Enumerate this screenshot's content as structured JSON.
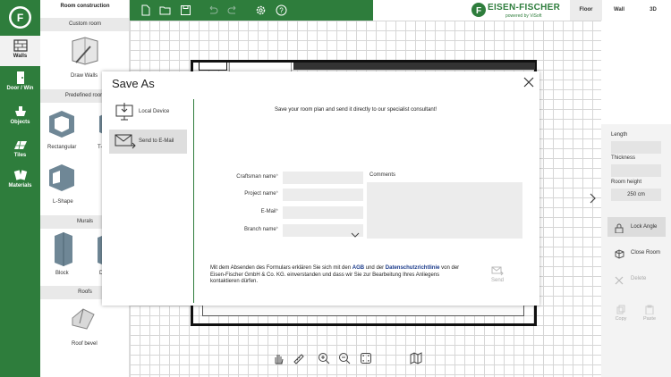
{
  "left_rail": {
    "items": [
      {
        "label": "Walls",
        "icon": "walls-icon",
        "active": true
      },
      {
        "label": "Door / Win",
        "icon": "door-window-icon"
      },
      {
        "label": "Objects",
        "icon": "objects-icon"
      },
      {
        "label": "Tiles",
        "icon": "tiles-icon"
      },
      {
        "label": "Materials",
        "icon": "materials-icon"
      }
    ]
  },
  "left_panel": {
    "title": "Room construction",
    "custom_room": {
      "heading": "Custom room",
      "items": [
        {
          "label": "Draw Walls"
        }
      ]
    },
    "predefined_room": {
      "heading": "Predefined room",
      "items": [
        {
          "label": "Rectangular"
        },
        {
          "label": "T-"
        },
        {
          "label": "L-Shape"
        }
      ]
    },
    "murals": {
      "heading": "Murals",
      "items": [
        {
          "label": "Block"
        },
        {
          "label": "D"
        }
      ]
    },
    "roofs": {
      "heading": "Roofs",
      "items": [
        {
          "label": "Roof bevel"
        }
      ]
    }
  },
  "topbar": {
    "icons": [
      "new-file-icon",
      "open-folder-icon",
      "save-icon",
      "undo-icon",
      "redo-icon",
      "settings-icon",
      "help-icon"
    ]
  },
  "brand": {
    "name": "EISEN-FISCHER",
    "tagline": "powered by ViSoft"
  },
  "view_tabs": [
    {
      "label": "Floor",
      "active": true
    },
    {
      "label": "Wall"
    },
    {
      "label": "3D"
    }
  ],
  "right_panel": {
    "length_label": "Length",
    "length_value": "",
    "thickness_label": "Thickness",
    "thickness_value": "",
    "room_height_label": "Room height",
    "room_height_value": "250 cm",
    "lock_angle": "Lock Angle",
    "close_room": "Close Room",
    "delete": "Delete",
    "copy": "Copy",
    "paste": "Paste"
  },
  "dialog": {
    "title": "Save As",
    "options": [
      {
        "label": "Local Device"
      },
      {
        "label": "Send to E-Mail",
        "selected": true
      }
    ],
    "intro": "Save your room plan and send it directly to our specialist consultant!",
    "fields": {
      "craftsman_name": {
        "label": "Craftsman name",
        "value": ""
      },
      "project_name": {
        "label": "Project name",
        "value": ""
      },
      "email": {
        "label": "E-Mail",
        "value": ""
      },
      "branch_name": {
        "label": "Branch name",
        "value": ""
      }
    },
    "required_mark": "*",
    "comments_label": "Comments",
    "consent_pre": "Mit dem Absenden des Formulars erklären Sie sich mit den ",
    "consent_agb": "AGB",
    "consent_mid": " und der ",
    "consent_privacy": "Datenschutzrichtlinie",
    "consent_post": " von der Eisen-Fischer GmbH & Co. KG. einverstanden und dass wir Sie zur Bearbeitung Ihres Anliegens kontaktieren dürfen.",
    "send_label": "Send"
  },
  "bottom_toolbar": {
    "icons": [
      "hand-pan-icon",
      "ruler-icon",
      "zoom-in-icon",
      "zoom-out-icon",
      "fit-view-icon",
      "map-icon"
    ]
  },
  "colors": {
    "brand_green": "#2e7d3c",
    "link_blue": "#1a3a8a"
  }
}
